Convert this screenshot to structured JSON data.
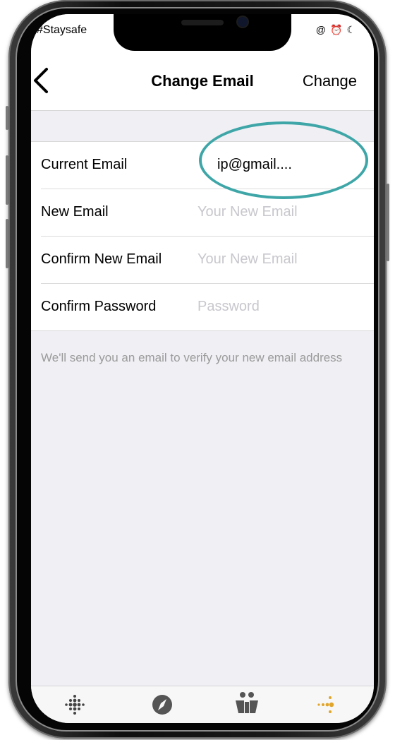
{
  "status_bar": {
    "carrier_text": "#Staysafe",
    "icons": [
      "at-icon",
      "alarm-icon",
      "moon-icon"
    ]
  },
  "nav": {
    "back_icon": "chevron-left-icon",
    "title": "Change Email",
    "action_label": "Change"
  },
  "form": {
    "rows": [
      {
        "label": "Current Email",
        "value": "ip@gmail...."
      },
      {
        "label": "New Email",
        "placeholder": "Your New Email"
      },
      {
        "label": "Confirm New Email",
        "placeholder": "Your New Email"
      },
      {
        "label": "Confirm Password",
        "placeholder": "Password"
      }
    ]
  },
  "footnote": "We'll send you an email to verify your new email address",
  "tab_bar": {
    "tabs": [
      {
        "icon": "dashboard-dots-icon",
        "color": "#444444"
      },
      {
        "icon": "compass-icon",
        "color": "#555555"
      },
      {
        "icon": "community-icon",
        "color": "#555555"
      },
      {
        "icon": "me-dots-icon",
        "color": "#e0a52a"
      }
    ]
  },
  "colors": {
    "highlight": "#3fa6a8",
    "background": "#efeff4",
    "placeholder": "#c7c7cd",
    "active_tab": "#e0a52a"
  }
}
